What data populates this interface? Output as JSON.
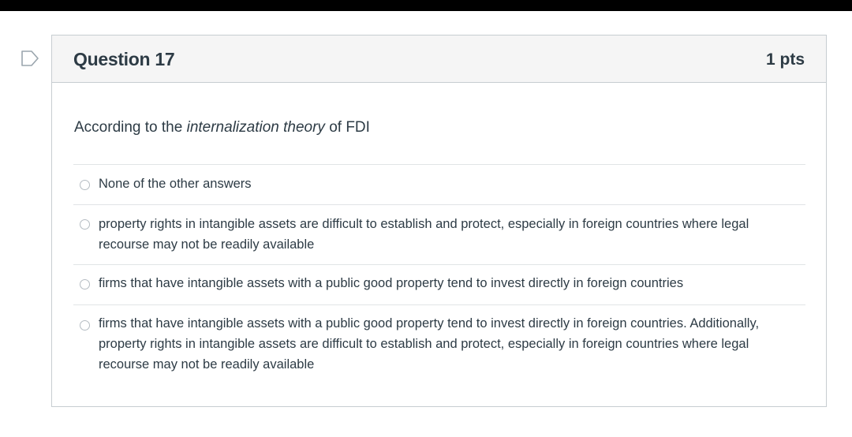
{
  "question": {
    "title": "Question 17",
    "points": "1 pts",
    "text_prefix": "According to the ",
    "text_emphasis": "internalization theory",
    "text_suffix": " of FDI"
  },
  "answers": [
    {
      "label": "None of the other answers"
    },
    {
      "label": "property rights in intangible assets are difficult to establish and protect, especially in foreign countries where legal recourse may not be readily available"
    },
    {
      "label": "firms that have intangible assets with a public good property tend to invest directly in foreign countries"
    },
    {
      "label": "firms that have intangible assets with a public good property tend to invest directly in foreign countries. Additionally, property rights in intangible assets are difficult to establish and protect, especially in foreign countries where legal recourse may not be readily available"
    }
  ],
  "icons": {
    "flag": "bookmark-flag-icon",
    "radio": "radio-circle-icon"
  },
  "colors": {
    "text": "#2d3b45",
    "header_bg": "#f5f5f5",
    "border": "#c7cdd1",
    "divider": "#e1e4e6",
    "top_bar": "#000000"
  }
}
